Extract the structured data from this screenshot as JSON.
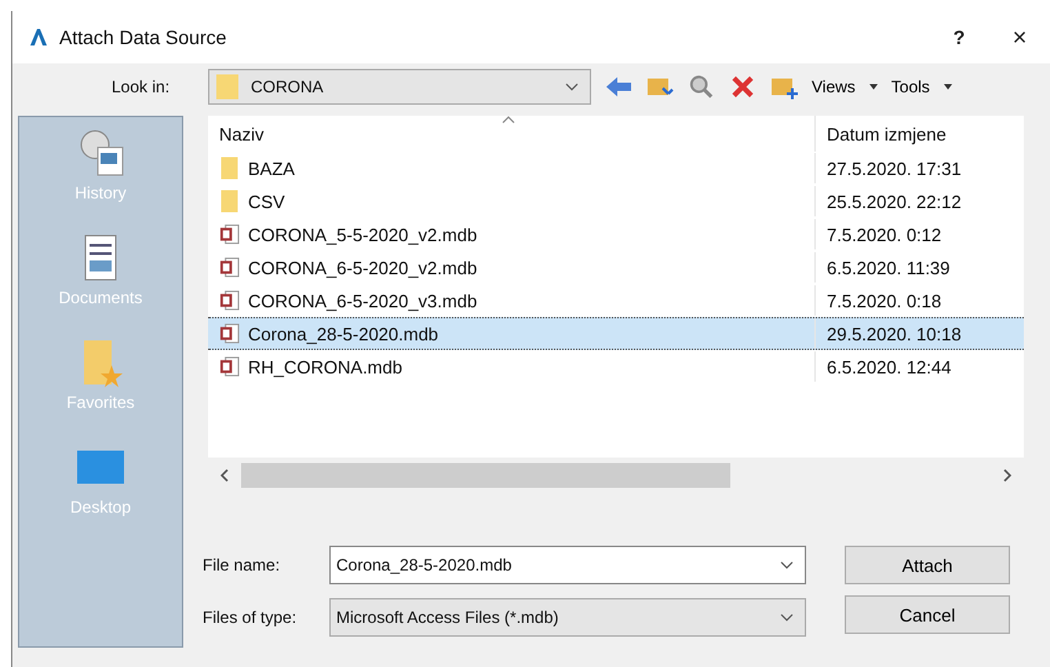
{
  "window": {
    "title": "Attach Data Source",
    "help": "?",
    "close": "×"
  },
  "look_in": {
    "label": "Look in:",
    "value": "CORONA"
  },
  "toolbar": {
    "views": "Views",
    "tools": "Tools"
  },
  "sidebar": {
    "items": [
      {
        "label": "History",
        "kind": "history"
      },
      {
        "label": "Documents",
        "kind": "documents"
      },
      {
        "label": "Favorites",
        "kind": "favorites"
      },
      {
        "label": "Desktop",
        "kind": "desktop"
      }
    ]
  },
  "table": {
    "columns": [
      "Naziv",
      "Datum izmjene"
    ],
    "rows": [
      {
        "name": "BAZA",
        "date": "27.5.2020. 17:31",
        "kind": "folder",
        "selected": false
      },
      {
        "name": "CSV",
        "date": "25.5.2020. 22:12",
        "kind": "folder",
        "selected": false
      },
      {
        "name": "CORONA_5-5-2020_v2.mdb",
        "date": "7.5.2020. 0:12",
        "kind": "mdb",
        "selected": false
      },
      {
        "name": "CORONA_6-5-2020_v2.mdb",
        "date": "6.5.2020. 11:39",
        "kind": "mdb",
        "selected": false
      },
      {
        "name": "CORONA_6-5-2020_v3.mdb",
        "date": "7.5.2020. 0:18",
        "kind": "mdb",
        "selected": false
      },
      {
        "name": "Corona_28-5-2020.mdb",
        "date": "29.5.2020. 10:18",
        "kind": "mdb",
        "selected": true
      },
      {
        "name": "RH_CORONA.mdb",
        "date": "6.5.2020. 12:44",
        "kind": "mdb",
        "selected": false
      }
    ]
  },
  "file_name": {
    "label": "File name:",
    "value": "Corona_28-5-2020.mdb"
  },
  "file_type": {
    "label": "Files of type:",
    "value": "Microsoft Access Files (*.mdb)"
  },
  "buttons": [
    "Attach",
    "Cancel"
  ]
}
